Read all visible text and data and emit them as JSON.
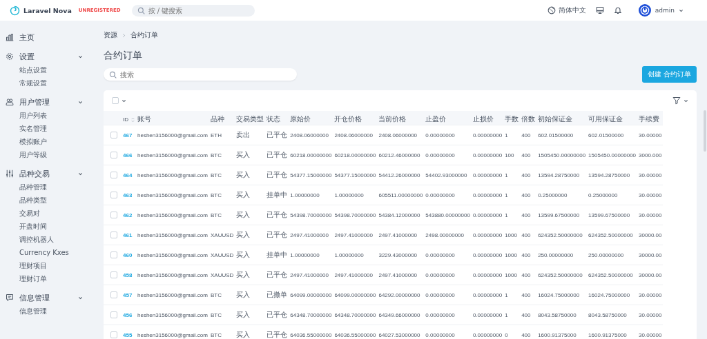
{
  "header": {
    "brand": "Laravel Nova",
    "badge": "UNREGISTERED",
    "search": {
      "placeholder": "按 / 键搜索"
    },
    "language": "简体中文",
    "user": "admin"
  },
  "sidebar": [
    {
      "label": "主页"
    },
    {
      "label": "设置",
      "expanded": true,
      "items": [
        "站点设置",
        "常规设置"
      ]
    },
    {
      "label": "用户管理",
      "expanded": true,
      "items": [
        "用户列表",
        "实名管理",
        "模拟账户",
        "用户等级"
      ]
    },
    {
      "label": "品种交易",
      "expanded": true,
      "items": [
        "品种管理",
        "品种类型",
        "交易对",
        "开盘时间",
        "调控机器人",
        "Currency Kxes",
        "理财项目",
        "理财订单"
      ]
    },
    {
      "label": "信息管理",
      "expanded": true,
      "items": [
        "信息管理"
      ]
    }
  ],
  "breadcrumb": [
    "资源",
    "合约订单"
  ],
  "title": "合约订单",
  "search": {
    "placeholder": "搜索"
  },
  "create_button": "创建 合约订单",
  "table": {
    "select_all": {
      "checked": false
    },
    "columns": [
      "ID",
      "账号",
      "品种",
      "交易类型",
      "状态",
      "原始价",
      "开仓价格",
      "当前价格",
      "止盈价",
      "止损价",
      "手数",
      "倍数",
      "初始保证金",
      "可用保证金",
      "手续费"
    ],
    "rows": [
      {
        "checked": false,
        "cells": [
          "467",
          "heshen3156000@gmail.com",
          "ETH",
          "卖出",
          "已平仓",
          "2408.06000000",
          "2408.06000000",
          "2408.06000000",
          "0.00000000",
          "0.00000000",
          "1",
          "400",
          "602.01500000",
          "602.01500000",
          "30.00000"
        ]
      },
      {
        "checked": false,
        "cells": [
          "466",
          "heshen3156000@gmail.com",
          "BTC",
          "买入",
          "已平仓",
          "60218.00000000",
          "60218.00000000",
          "60212.46000000",
          "0.00000000",
          "0.00000000",
          "100",
          "400",
          "1505450.00000000",
          "1505450.00000000",
          "3000.000"
        ]
      },
      {
        "checked": false,
        "cells": [
          "464",
          "heshen3156000@gmail.com",
          "BTC",
          "买入",
          "已平仓",
          "54377.15000000",
          "54377.15000000",
          "54412.26000000",
          "54402.93000000",
          "0.00000000",
          "1",
          "400",
          "13594.28750000",
          "13594.28750000",
          "30.00000"
        ]
      },
      {
        "checked": false,
        "cells": [
          "463",
          "heshen3156000@gmail.com",
          "BTC",
          "买入",
          "挂单中",
          "1.00000000",
          "1.00000000",
          "605511.00000000",
          "0.00000000",
          "0.00000000",
          "1",
          "400",
          "0.25000000",
          "0.25000000",
          "30.00000"
        ]
      },
      {
        "checked": false,
        "cells": [
          "462",
          "heshen3156000@gmail.com",
          "BTC",
          "买入",
          "已平仓",
          "54398.70000000",
          "54398.70000000",
          "54384.12000000",
          "543880.00000000",
          "0.00000000",
          "1",
          "400",
          "13599.67500000",
          "13599.67500000",
          "30.00000"
        ]
      },
      {
        "checked": false,
        "cells": [
          "461",
          "heshen3156000@gmail.com",
          "XAUUSD",
          "买入",
          "已平仓",
          "2497.41000000",
          "2497.41000000",
          "2497.41000000",
          "2498.00000000",
          "0.00000000",
          "1000",
          "400",
          "624352.50000000",
          "624352.50000000",
          "30000.00"
        ]
      },
      {
        "checked": false,
        "cells": [
          "460",
          "heshen3156000@gmail.com",
          "XAUUSD",
          "买入",
          "挂单中",
          "1.00000000",
          "1.00000000",
          "3229.43000000",
          "0.00000000",
          "0.00000000",
          "1000",
          "400",
          "250.00000000",
          "250.00000000",
          "30000.00"
        ]
      },
      {
        "checked": false,
        "cells": [
          "458",
          "heshen3156000@gmail.com",
          "XAUUSD",
          "买入",
          "已平仓",
          "2497.41000000",
          "2497.41000000",
          "2497.41000000",
          "0.00000000",
          "0.00000000",
          "1000",
          "400",
          "624352.50000000",
          "624352.50000000",
          "30000.00"
        ]
      },
      {
        "checked": false,
        "cells": [
          "457",
          "heshen3156000@gmail.com",
          "BTC",
          "买入",
          "已撤单",
          "64099.00000000",
          "64099.00000000",
          "64292.00000000",
          "0.00000000",
          "0.00000000",
          "1",
          "400",
          "16024.75000000",
          "16024.75000000",
          "30.00000"
        ]
      },
      {
        "checked": false,
        "cells": [
          "456",
          "heshen3156000@gmail.com",
          "BTC",
          "买入",
          "已平仓",
          "64348.70000000",
          "64348.70000000",
          "64349.66000000",
          "0.00000000",
          "0.00000000",
          "1",
          "400",
          "8043.58750000",
          "8043.58750000",
          "30.00000"
        ]
      },
      {
        "checked": false,
        "cells": [
          "455",
          "heshen3156000@gmail.com",
          "BTC",
          "买入",
          "已平仓",
          "64036.55000000",
          "64036.55000000",
          "64027.53000000",
          "0.00000000",
          "0.00000000",
          "0",
          "400",
          "1600.91375000",
          "1600.91375000",
          "30.00000"
        ]
      }
    ]
  }
}
